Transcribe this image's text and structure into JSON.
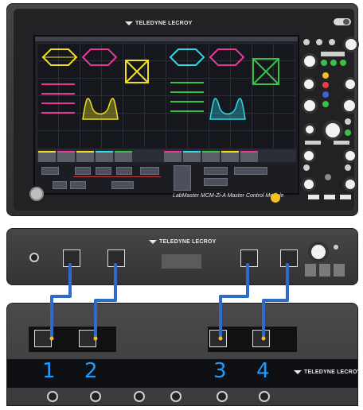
{
  "top_unit": {
    "brand": "TELEDYNE LECROY",
    "footer_text": "LabMaster MCM-Zi-A Master Control Module"
  },
  "middle_unit": {
    "brand": "TELEDYNE LECROY"
  },
  "bottom_unit": {
    "brand": "TELEDYNE LECROY",
    "channels": [
      "1",
      "2",
      "3",
      "4"
    ]
  },
  "colors": {
    "cable": "#2f6bc8",
    "channel_number": "#1e9bff",
    "trace_yellow": "#f0e020",
    "trace_magenta": "#e8389c",
    "trace_cyan": "#30d8e8",
    "trace_green": "#3ac04a",
    "led_yellow": "#f0c020"
  },
  "icons": [
    "teledyne-logo-icon",
    "power-button-icon",
    "led-indicator-icon",
    "control-knob-icon"
  ]
}
